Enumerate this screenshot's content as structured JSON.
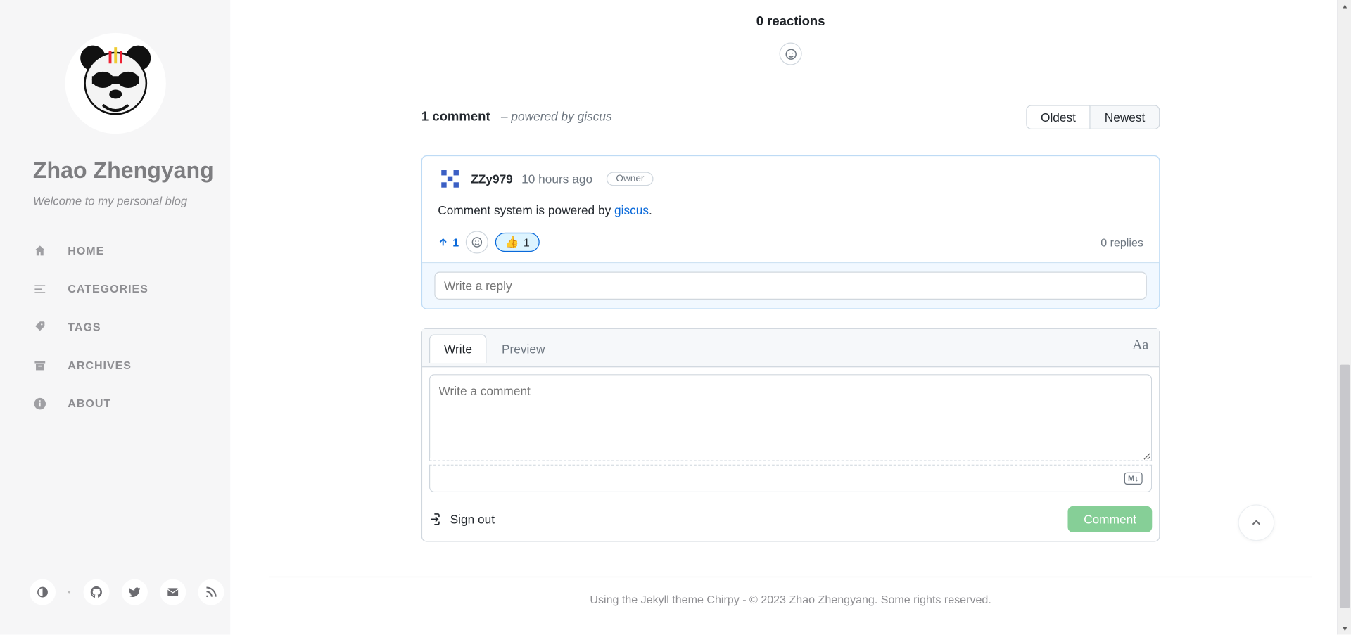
{
  "sidebar": {
    "owner_name": "Zhao Zhengyang",
    "subtitle": "Welcome to my personal blog",
    "nav": {
      "home": "HOME",
      "categories": "CATEGORIES",
      "tags": "TAGS",
      "archives": "ARCHIVES",
      "about": "ABOUT"
    }
  },
  "reactions": {
    "header": "0 reactions"
  },
  "comments_summary": {
    "count_label": "1 comment",
    "powered": "– powered by giscus",
    "sort_oldest": "Oldest",
    "sort_newest": "Newest"
  },
  "comment": {
    "author": "ZZy979",
    "time": "10 hours ago",
    "badge": "Owner",
    "body_prefix": "Comment system is powered by ",
    "body_link": "giscus",
    "body_suffix": ".",
    "upvote_count": "1",
    "thumbs_emoji": "👍",
    "thumbs_count": "1",
    "replies_label": "0 replies",
    "reply_placeholder": "Write a reply"
  },
  "editor": {
    "tab_write": "Write",
    "tab_preview": "Preview",
    "placeholder": "Write a comment",
    "aa": "Aa",
    "md_badge": "M↓",
    "signout": "Sign out",
    "submit": "Comment"
  },
  "footer": {
    "using": "Using the ",
    "jekyll": "Jekyll",
    "theme": " theme ",
    "chirpy": "Chirpy",
    "sep": "    -    ",
    "copyright_pre": "© 2023 ",
    "owner": "Zhao Zhengyang",
    "copyright_post": ". Some rights reserved."
  }
}
